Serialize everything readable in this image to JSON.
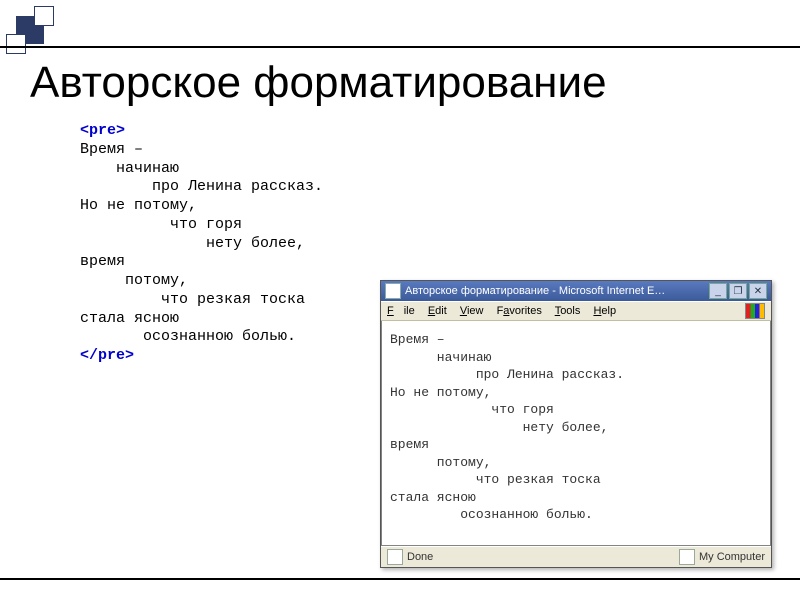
{
  "slide": {
    "title": "Авторское форматирование"
  },
  "code": {
    "open_tag": "<pre>",
    "close_tag": "</pre>",
    "body": "Время –\n    начинаю\n        про Ленина рассказ.\nНо не потому,\n          что горя\n              нету более,\nвремя\n     потому,\n         что резкая тоска\nстала ясною\n       осознанною болью."
  },
  "browser": {
    "title_text": "Авторское форматирование - Microsoft Internet E…",
    "menu": {
      "file": "File",
      "edit": "Edit",
      "view": "View",
      "favorites": "Favorites",
      "tools": "Tools",
      "help": "Help"
    },
    "controls": {
      "min": "_",
      "max": "❐",
      "close": "✕"
    },
    "content": "Время –\n      начинаю\n           про Ленина рассказ.\nНо не потому,\n             что горя\n                 нету более,\nвремя\n      потому,\n           что резкая тоска\nстала ясною\n         осознанною болью.",
    "status": {
      "left": "Done",
      "right": "My Computer"
    }
  }
}
